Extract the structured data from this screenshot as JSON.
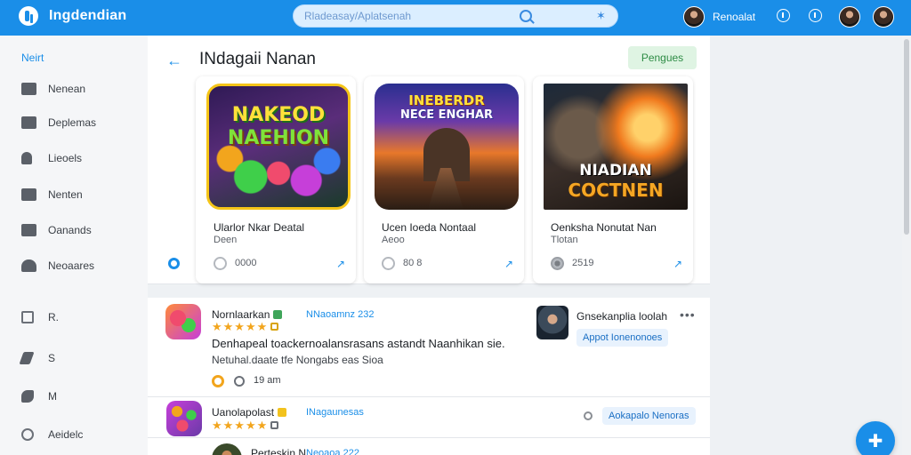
{
  "topbar": {
    "app_title": "Ingdendian",
    "search_placeholder": "Rladeasay/Aplatsenah",
    "user_name": "Renoalat"
  },
  "sidebar": {
    "heading": "Neirt",
    "items": [
      {
        "label": "Nenean",
        "icon": "home-icon"
      },
      {
        "label": "Deplemas",
        "icon": "chat-icon"
      },
      {
        "label": "Lieoels",
        "icon": "user-icon"
      },
      {
        "label": "Nenten",
        "icon": "book-icon"
      },
      {
        "label": "Oanands",
        "icon": "mail-icon"
      },
      {
        "label": "Neoaares",
        "icon": "cloud-icon"
      },
      {
        "label": "R.",
        "icon": "shield-icon"
      },
      {
        "label": "S",
        "icon": "send-icon"
      },
      {
        "label": "M",
        "icon": "megaphone-icon"
      },
      {
        "label": "Aeidelc",
        "icon": "settings-icon"
      }
    ]
  },
  "featured": {
    "title": "INdagaii Nanan",
    "filter_label": "Pengues",
    "cards": [
      {
        "art_title_1": "NAKEOD",
        "art_title_2": "NAEHION",
        "name": "Ularlor Nkar Deatal",
        "sub": "Deen",
        "count": "0000"
      },
      {
        "art_title_1": "INEBERDR",
        "art_title_2": "NECE ENGHAR",
        "name": "Ucen Ioeda Nontaal",
        "sub": "Aeoo",
        "count": "80 8"
      },
      {
        "art_title_1": "NIADIAN",
        "art_title_2": "COCTNEN",
        "name": "Oenksha Nonutat Nan",
        "sub": "Tlotan",
        "count": "2519"
      }
    ]
  },
  "list": {
    "rows": [
      {
        "title": "Nornlaarkan",
        "meta": "NNaoamnz 232",
        "desc": "Denhapeal toackernoalansrasans astandt Naanhikan sie.",
        "tag": "Netuhal.daate tfe Nongabs eas Sioa",
        "time": "19 am"
      },
      {
        "title": "Uanolapolast",
        "meta": "INagaunesas"
      },
      {
        "title": "Perteskin N",
        "meta": "Neoaoa 222"
      }
    ],
    "side_user": {
      "name": "Gnsekanplia loolah",
      "chip": "Appot Ionenonoes"
    },
    "row2_chip": "Aokapalo Nenoras"
  }
}
